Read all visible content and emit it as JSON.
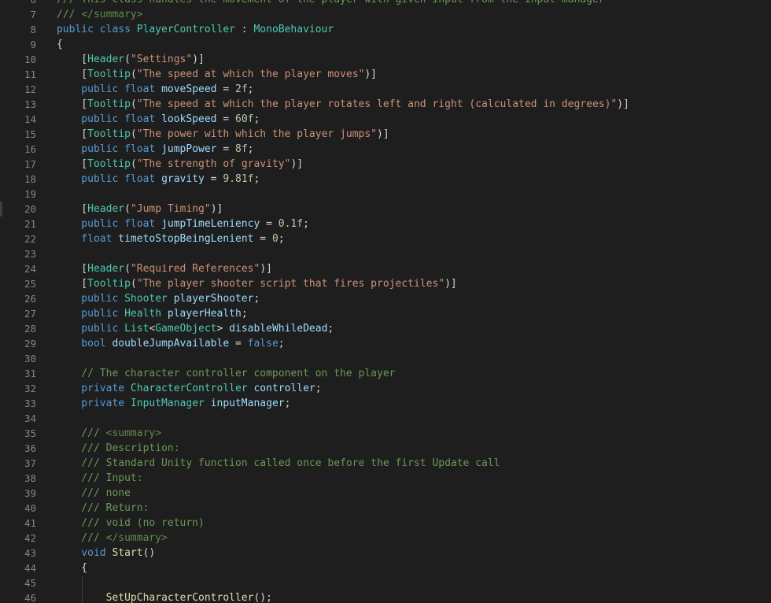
{
  "editor": {
    "lines": [
      {
        "number": "6",
        "tokens": [
          {
            "t": "/// This class handles the movement of the player with given input from the input manager",
            "c": "cmt"
          }
        ]
      },
      {
        "number": "7",
        "tokens": [
          {
            "t": "/// ",
            "c": "cmt"
          },
          {
            "t": "</summary>",
            "c": "xml"
          }
        ]
      },
      {
        "number": "8",
        "tokens": [
          {
            "t": "public class ",
            "c": "kw"
          },
          {
            "t": "PlayerController",
            "c": "type"
          },
          {
            "t": " : ",
            "c": "punc"
          },
          {
            "t": "MonoBehaviour",
            "c": "type"
          }
        ]
      },
      {
        "number": "9",
        "tokens": [
          {
            "t": "{",
            "c": "punc"
          }
        ]
      },
      {
        "number": "10",
        "tokens": [
          {
            "t": "    [",
            "c": "punc"
          },
          {
            "t": "Header",
            "c": "attr"
          },
          {
            "t": "(",
            "c": "punc"
          },
          {
            "t": "\"Settings\"",
            "c": "str"
          },
          {
            "t": ")]",
            "c": "punc"
          }
        ]
      },
      {
        "number": "11",
        "tokens": [
          {
            "t": "    [",
            "c": "punc"
          },
          {
            "t": "Tooltip",
            "c": "attr"
          },
          {
            "t": "(",
            "c": "punc"
          },
          {
            "t": "\"The speed at which the player moves\"",
            "c": "str"
          },
          {
            "t": ")]",
            "c": "punc"
          }
        ]
      },
      {
        "number": "12",
        "tokens": [
          {
            "t": "    public float ",
            "c": "kw"
          },
          {
            "t": "moveSpeed",
            "c": "var"
          },
          {
            "t": " = ",
            "c": "punc"
          },
          {
            "t": "2f",
            "c": "num"
          },
          {
            "t": ";",
            "c": "punc"
          }
        ]
      },
      {
        "number": "13",
        "tokens": [
          {
            "t": "    [",
            "c": "punc"
          },
          {
            "t": "Tooltip",
            "c": "attr"
          },
          {
            "t": "(",
            "c": "punc"
          },
          {
            "t": "\"The speed at which the player rotates left and right (calculated in degrees)\"",
            "c": "str"
          },
          {
            "t": ")]",
            "c": "punc"
          }
        ]
      },
      {
        "number": "14",
        "tokens": [
          {
            "t": "    public float ",
            "c": "kw"
          },
          {
            "t": "lookSpeed",
            "c": "var"
          },
          {
            "t": " = ",
            "c": "punc"
          },
          {
            "t": "60f",
            "c": "num"
          },
          {
            "t": ";",
            "c": "punc"
          }
        ]
      },
      {
        "number": "15",
        "tokens": [
          {
            "t": "    [",
            "c": "punc"
          },
          {
            "t": "Tooltip",
            "c": "attr"
          },
          {
            "t": "(",
            "c": "punc"
          },
          {
            "t": "\"The power with which the player jumps\"",
            "c": "str"
          },
          {
            "t": ")]",
            "c": "punc"
          }
        ]
      },
      {
        "number": "16",
        "tokens": [
          {
            "t": "    public float ",
            "c": "kw"
          },
          {
            "t": "jumpPower",
            "c": "var"
          },
          {
            "t": " = ",
            "c": "punc"
          },
          {
            "t": "8f",
            "c": "num"
          },
          {
            "t": ";",
            "c": "punc"
          }
        ]
      },
      {
        "number": "17",
        "tokens": [
          {
            "t": "    [",
            "c": "punc"
          },
          {
            "t": "Tooltip",
            "c": "attr"
          },
          {
            "t": "(",
            "c": "punc"
          },
          {
            "t": "\"The strength of gravity\"",
            "c": "str"
          },
          {
            "t": ")]",
            "c": "punc"
          }
        ]
      },
      {
        "number": "18",
        "tokens": [
          {
            "t": "    public float ",
            "c": "kw"
          },
          {
            "t": "gravity",
            "c": "var"
          },
          {
            "t": " = ",
            "c": "punc"
          },
          {
            "t": "9.81f",
            "c": "num"
          },
          {
            "t": ";",
            "c": "punc"
          }
        ]
      },
      {
        "number": "19",
        "tokens": []
      },
      {
        "number": "20",
        "tokens": [
          {
            "t": "    [",
            "c": "punc"
          },
          {
            "t": "Header",
            "c": "attr"
          },
          {
            "t": "(",
            "c": "punc"
          },
          {
            "t": "\"Jump Timing\"",
            "c": "str"
          },
          {
            "t": ")]",
            "c": "punc"
          }
        ]
      },
      {
        "number": "21",
        "tokens": [
          {
            "t": "    public float ",
            "c": "kw"
          },
          {
            "t": "jumpTimeLeniency",
            "c": "var"
          },
          {
            "t": " = ",
            "c": "punc"
          },
          {
            "t": "0.1f",
            "c": "num"
          },
          {
            "t": ";",
            "c": "punc"
          }
        ]
      },
      {
        "number": "22",
        "tokens": [
          {
            "t": "    float ",
            "c": "kw"
          },
          {
            "t": "timetoStopBeingLenient",
            "c": "var"
          },
          {
            "t": " = ",
            "c": "punc"
          },
          {
            "t": "0",
            "c": "num"
          },
          {
            "t": ";",
            "c": "punc"
          }
        ]
      },
      {
        "number": "23",
        "tokens": []
      },
      {
        "number": "24",
        "tokens": [
          {
            "t": "    [",
            "c": "punc"
          },
          {
            "t": "Header",
            "c": "attr"
          },
          {
            "t": "(",
            "c": "punc"
          },
          {
            "t": "\"Required References\"",
            "c": "str"
          },
          {
            "t": ")]",
            "c": "punc"
          }
        ]
      },
      {
        "number": "25",
        "tokens": [
          {
            "t": "    [",
            "c": "punc"
          },
          {
            "t": "Tooltip",
            "c": "attr"
          },
          {
            "t": "(",
            "c": "punc"
          },
          {
            "t": "\"The player shooter script that fires projectiles\"",
            "c": "str"
          },
          {
            "t": ")]",
            "c": "punc"
          }
        ]
      },
      {
        "number": "26",
        "tokens": [
          {
            "t": "    public ",
            "c": "kw"
          },
          {
            "t": "Shooter",
            "c": "type"
          },
          {
            "t": " ",
            "c": "punc"
          },
          {
            "t": "playerShooter",
            "c": "var"
          },
          {
            "t": ";",
            "c": "punc"
          }
        ]
      },
      {
        "number": "27",
        "tokens": [
          {
            "t": "    public ",
            "c": "kw"
          },
          {
            "t": "Health",
            "c": "type"
          },
          {
            "t": " ",
            "c": "punc"
          },
          {
            "t": "playerHealth",
            "c": "var"
          },
          {
            "t": ";",
            "c": "punc"
          }
        ]
      },
      {
        "number": "28",
        "tokens": [
          {
            "t": "    public ",
            "c": "kw"
          },
          {
            "t": "List",
            "c": "type"
          },
          {
            "t": "<",
            "c": "punc"
          },
          {
            "t": "GameObject",
            "c": "type"
          },
          {
            "t": "> ",
            "c": "punc"
          },
          {
            "t": "disableWhileDead",
            "c": "var"
          },
          {
            "t": ";",
            "c": "punc"
          }
        ]
      },
      {
        "number": "29",
        "tokens": [
          {
            "t": "    bool ",
            "c": "kw"
          },
          {
            "t": "doubleJumpAvailable",
            "c": "var"
          },
          {
            "t": " = ",
            "c": "punc"
          },
          {
            "t": "false",
            "c": "kw"
          },
          {
            "t": ";",
            "c": "punc"
          }
        ]
      },
      {
        "number": "30",
        "tokens": []
      },
      {
        "number": "31",
        "tokens": [
          {
            "t": "    // The character controller component on the player",
            "c": "cmt"
          }
        ]
      },
      {
        "number": "32",
        "tokens": [
          {
            "t": "    private ",
            "c": "kw"
          },
          {
            "t": "CharacterController",
            "c": "type"
          },
          {
            "t": " ",
            "c": "punc"
          },
          {
            "t": "controller",
            "c": "var"
          },
          {
            "t": ";",
            "c": "punc"
          }
        ]
      },
      {
        "number": "33",
        "tokens": [
          {
            "t": "    private ",
            "c": "kw"
          },
          {
            "t": "InputManager",
            "c": "type"
          },
          {
            "t": " ",
            "c": "punc"
          },
          {
            "t": "inputManager",
            "c": "var"
          },
          {
            "t": ";",
            "c": "punc"
          }
        ]
      },
      {
        "number": "34",
        "tokens": []
      },
      {
        "number": "35",
        "tokens": [
          {
            "t": "    /// ",
            "c": "cmt"
          },
          {
            "t": "<summary>",
            "c": "xml"
          }
        ]
      },
      {
        "number": "36",
        "tokens": [
          {
            "t": "    /// Description:",
            "c": "cmt"
          }
        ]
      },
      {
        "number": "37",
        "tokens": [
          {
            "t": "    /// Standard Unity function called once before the first Update call",
            "c": "cmt"
          }
        ]
      },
      {
        "number": "38",
        "tokens": [
          {
            "t": "    /// Input:",
            "c": "cmt"
          }
        ]
      },
      {
        "number": "39",
        "tokens": [
          {
            "t": "    /// none",
            "c": "cmt"
          }
        ]
      },
      {
        "number": "40",
        "tokens": [
          {
            "t": "    /// Return:",
            "c": "cmt"
          }
        ]
      },
      {
        "number": "41",
        "tokens": [
          {
            "t": "    /// void (no return)",
            "c": "cmt"
          }
        ]
      },
      {
        "number": "42",
        "tokens": [
          {
            "t": "    /// ",
            "c": "cmt"
          },
          {
            "t": "</summary>",
            "c": "xml"
          }
        ]
      },
      {
        "number": "43",
        "tokens": [
          {
            "t": "    void ",
            "c": "kw"
          },
          {
            "t": "Start",
            "c": "fn"
          },
          {
            "t": "()",
            "c": "punc"
          }
        ]
      },
      {
        "number": "44",
        "tokens": [
          {
            "t": "    {",
            "c": "punc"
          }
        ]
      },
      {
        "number": "45",
        "tokens": []
      },
      {
        "number": "46",
        "tokens": [
          {
            "t": "        ",
            "c": "punc"
          },
          {
            "t": "SetUpCharacterController",
            "c": "fn"
          },
          {
            "t": "();",
            "c": "punc"
          }
        ]
      }
    ]
  }
}
